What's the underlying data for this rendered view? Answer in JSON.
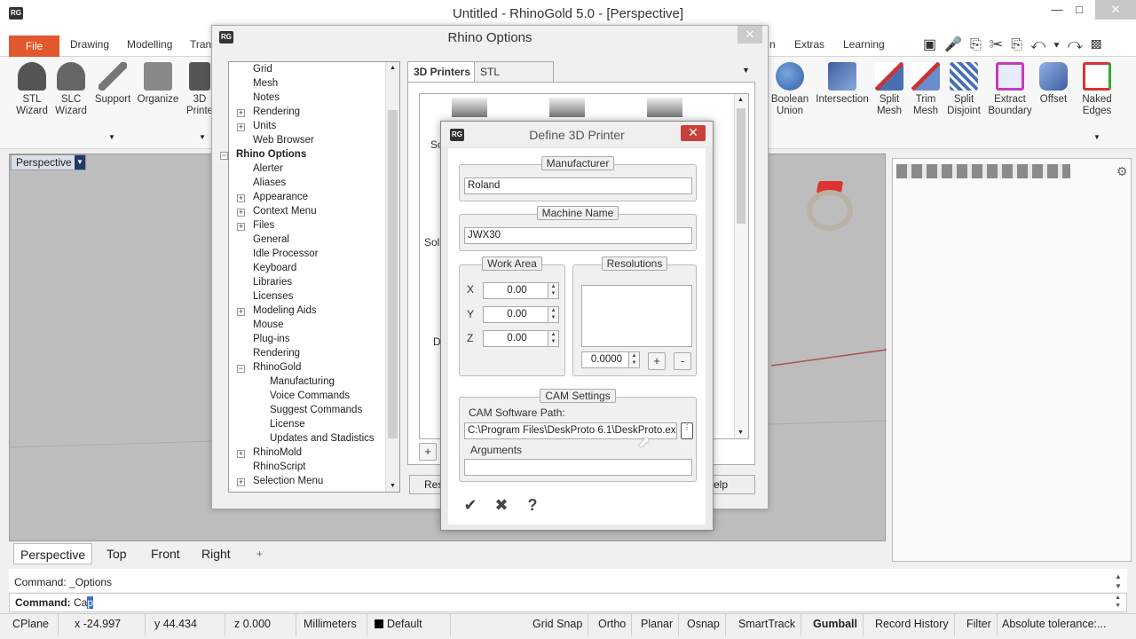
{
  "window": {
    "title": "Untitled - RhinoGold 5.0 - [Perspective]",
    "logo": "RG"
  },
  "menu": {
    "file": "File",
    "tabs": [
      "Drawing",
      "Modelling",
      "Tran",
      "n",
      "Extras",
      "Learning"
    ]
  },
  "ribbon": {
    "left_buttons": [
      {
        "line1": "STL",
        "line2": "Wizard"
      },
      {
        "line1": "SLC",
        "line2": "Wizard"
      },
      {
        "line1": "Support",
        "line2": ""
      },
      {
        "line1": "Organize",
        "line2": ""
      },
      {
        "line1": "3D",
        "line2": "Printe"
      }
    ],
    "right_buttons": [
      {
        "line1": "Boolean",
        "line2": "Union"
      },
      {
        "line1": "Intersection",
        "line2": ""
      },
      {
        "line1": "Split",
        "line2": "Mesh"
      },
      {
        "line1": "Trim",
        "line2": "Mesh"
      },
      {
        "line1": "Split",
        "line2": "Disjoint"
      },
      {
        "line1": "Extract",
        "line2": "Boundary"
      },
      {
        "line1": "Offset",
        "line2": ""
      },
      {
        "line1": "Naked",
        "line2": "Edges"
      }
    ]
  },
  "viewport": {
    "label": "Perspective",
    "tabs": [
      "Perspective",
      "Top",
      "Front",
      "Right",
      "+"
    ]
  },
  "rhino_options": {
    "title": "Rhino Options",
    "tree": [
      {
        "label": "Grid",
        "level": 1,
        "expander": ""
      },
      {
        "label": "Mesh",
        "level": 1,
        "expander": ""
      },
      {
        "label": "Notes",
        "level": 1,
        "expander": ""
      },
      {
        "label": "Rendering",
        "level": 1,
        "expander": "+"
      },
      {
        "label": "Units",
        "level": 1,
        "expander": "+"
      },
      {
        "label": "Web Browser",
        "level": 1,
        "expander": ""
      },
      {
        "label": "Rhino Options",
        "level": 0,
        "expander": "−"
      },
      {
        "label": "Alerter",
        "level": 1,
        "expander": ""
      },
      {
        "label": "Aliases",
        "level": 1,
        "expander": ""
      },
      {
        "label": "Appearance",
        "level": 1,
        "expander": "+"
      },
      {
        "label": "Context Menu",
        "level": 1,
        "expander": "+"
      },
      {
        "label": "Files",
        "level": 1,
        "expander": "+"
      },
      {
        "label": "General",
        "level": 1,
        "expander": ""
      },
      {
        "label": "Idle Processor",
        "level": 1,
        "expander": ""
      },
      {
        "label": "Keyboard",
        "level": 1,
        "expander": ""
      },
      {
        "label": "Libraries",
        "level": 1,
        "expander": ""
      },
      {
        "label": "Licenses",
        "level": 1,
        "expander": ""
      },
      {
        "label": "Modeling Aids",
        "level": 1,
        "expander": "+"
      },
      {
        "label": "Mouse",
        "level": 1,
        "expander": ""
      },
      {
        "label": "Plug-ins",
        "level": 1,
        "expander": ""
      },
      {
        "label": "Rendering",
        "level": 1,
        "expander": ""
      },
      {
        "label": "RhinoGold",
        "level": 1,
        "expander": "−"
      },
      {
        "label": "Manufacturing",
        "level": 2,
        "expander": ""
      },
      {
        "label": "Voice Commands",
        "level": 2,
        "expander": ""
      },
      {
        "label": "Suggest Commands",
        "level": 2,
        "expander": ""
      },
      {
        "label": "License",
        "level": 2,
        "expander": ""
      },
      {
        "label": "Updates and Stadistics",
        "level": 2,
        "expander": ""
      },
      {
        "label": "RhinoMold",
        "level": 1,
        "expander": "+"
      },
      {
        "label": "RhinoScript",
        "level": 1,
        "expander": ""
      },
      {
        "label": "Selection Menu",
        "level": 1,
        "expander": "+"
      }
    ],
    "tabs": [
      "3D Printers",
      "STL Parameters"
    ],
    "partial_labels": [
      "So",
      "Soli",
      "D"
    ],
    "add_button": "+",
    "reset_partial": "Res",
    "help_partial": "elp"
  },
  "define_printer": {
    "title": "Define 3D Printer",
    "manufacturer_label": "Manufacturer",
    "manufacturer_value": "Roland",
    "machine_label": "Machine Name",
    "machine_value": "JWX30",
    "work_area_label": "Work Area",
    "axes": [
      {
        "axis": "X",
        "value": "0.00"
      },
      {
        "axis": "Y",
        "value": "0.00"
      },
      {
        "axis": "Z",
        "value": "0.00"
      }
    ],
    "resolutions_label": "Resolutions",
    "resolution_value": "0.0000",
    "plus": "+",
    "minus": "-",
    "cam_label": "CAM Settings",
    "cam_path_label": "CAM Software Path:",
    "cam_path_value": "C:\\Program Files\\DeskProto 6.1\\DeskProto.exe",
    "arguments_label": "Arguments",
    "arguments_value": "",
    "ok": "✔",
    "cancel": "✖",
    "help": "?"
  },
  "command": {
    "history": "Command: _Options",
    "prompt": "Command:",
    "input_plain": "Ca",
    "input_selected": "p"
  },
  "status": {
    "cplane": "CPlane",
    "x": "x -24.997",
    "y": "y 44.434",
    "z": "z 0.000",
    "units": "Millimeters",
    "layer": "Default",
    "grid_snap": "Grid Snap",
    "ortho": "Ortho",
    "planar": "Planar",
    "osnap": "Osnap",
    "smarttrack": "SmartTrack",
    "gumball": "Gumball",
    "record_history": "Record History",
    "filter": "Filter",
    "tolerance": "Absolute tolerance:..."
  },
  "colors": {
    "file_tab": "#e2582e",
    "close_red": "#c7413a",
    "viewport_bg": "#bdbdbd"
  }
}
